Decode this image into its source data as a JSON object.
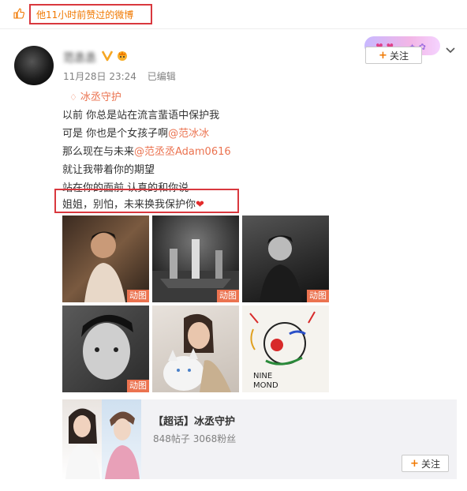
{
  "banner": {
    "liked_text": "他11小时前赞过的微博"
  },
  "author": {
    "name": "范丞丞",
    "post_time": "11月28日 23:24",
    "edited": "已编辑"
  },
  "follow": {
    "label": "关注"
  },
  "topic": {
    "label": "冰丞守护"
  },
  "post": {
    "line1": "以前 你总是站在流言蜚语中保护我",
    "line2_prefix": "可是 你也是个女孩子啊",
    "line2_mention": "@范冰冰",
    "line3_prefix": "那么现在与未来",
    "line3_mention": "@范丞丞Adam0616",
    "line4": "就让我带着你的期望",
    "line5": "站在你的面前 认真的和你说",
    "line6": "姐姐，别怕，未来换我保护你"
  },
  "images": {
    "gif_tag": "动图",
    "img6_text_a": "NINE",
    "img6_text_b": "MOND"
  },
  "super_topic": {
    "title": "【超话】冰丞守护",
    "stats": "848帖子 3068粉丝",
    "follow_label": "关注"
  },
  "colors": {
    "accent": "#eb7350",
    "highlight_box": "#d9383e",
    "liked_text": "#f07800"
  }
}
